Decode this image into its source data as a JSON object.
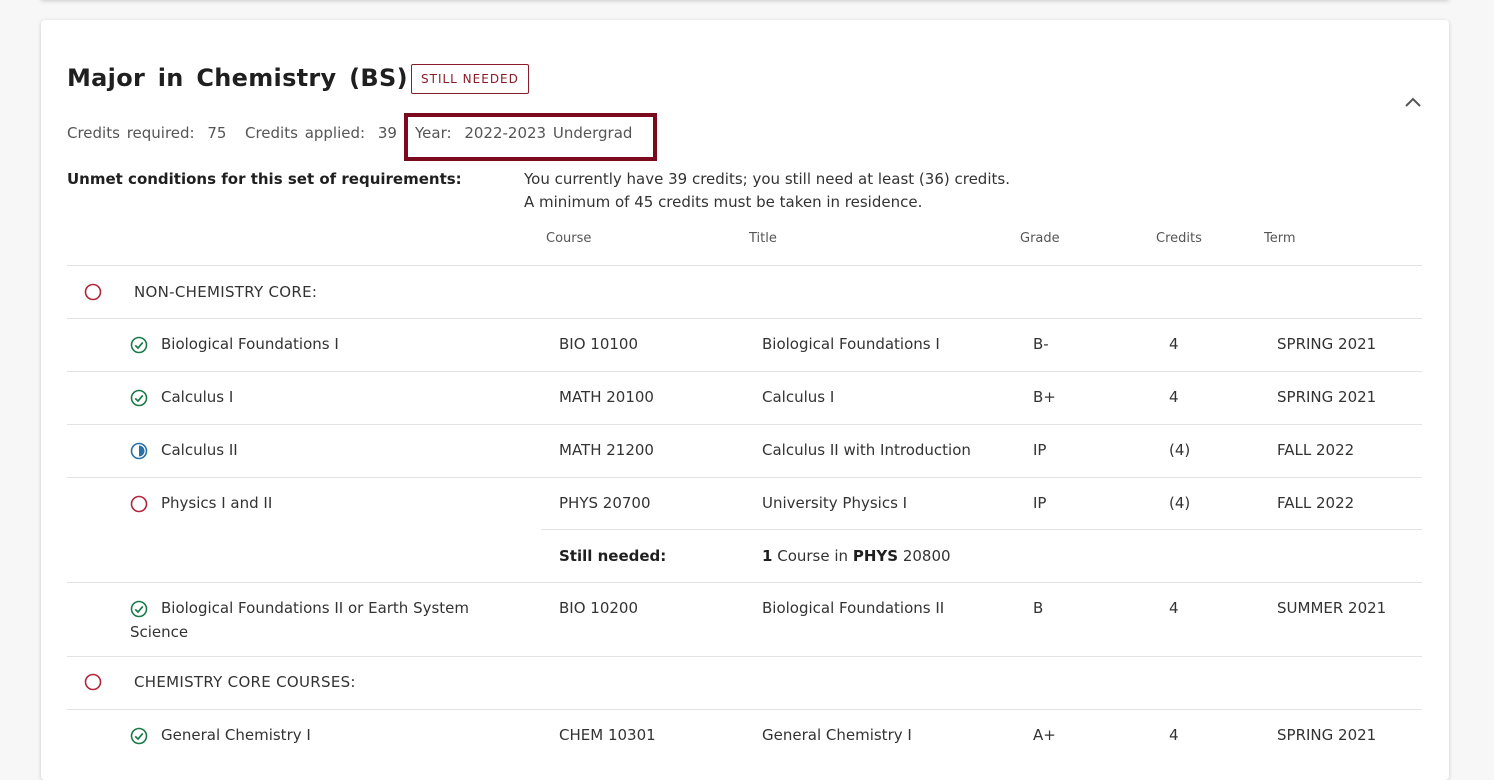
{
  "header": {
    "title": "Major in Chemistry (BS)",
    "status_badge": "STILL NEEDED",
    "credits_required_label": "Credits required:",
    "credits_required": "75",
    "credits_applied_label": "Credits applied:",
    "credits_applied": "39",
    "year_label": "Year:",
    "year": "2022-2023 Undergrad"
  },
  "unmet": {
    "label": "Unmet conditions for this set of requirements:",
    "messages": [
      "You currently have 39 credits; you still need at least (36) credits.",
      "A minimum of 45 credits must be taken in residence."
    ]
  },
  "columns": [
    "Course",
    "Title",
    "Grade",
    "Credits",
    "Term"
  ],
  "groups": [
    {
      "label": "NON-CHEMISTRY CORE:",
      "status": "not-met",
      "rows": [
        {
          "requirement": "Biological Foundations I",
          "status": "complete",
          "course": "BIO 10100",
          "title": "Biological Foundations I",
          "grade": "B-",
          "credits": "4",
          "term": "SPRING 2021"
        },
        {
          "requirement": "Calculus I",
          "status": "complete",
          "course": "MATH 20100",
          "title": "Calculus I",
          "grade": "B+",
          "credits": "4",
          "term": "SPRING 2021"
        },
        {
          "requirement": "Calculus II",
          "status": "in-progress",
          "course": "MATH 21200",
          "title": "Calculus II with Introduction",
          "grade": "IP",
          "credits": "(4)",
          "term": "FALL 2022"
        },
        {
          "requirement": "Physics I and II",
          "status": "not-met",
          "course": "PHYS 20700",
          "title": "University Physics I",
          "grade": "IP",
          "credits": "(4)",
          "term": "FALL 2022",
          "still_needed": {
            "label": "Still needed:",
            "count": "1",
            "word_course": "Course",
            "word_in": "in",
            "subject": "PHYS",
            "number": "20800"
          }
        },
        {
          "requirement_line1": "Biological Foundations II or Earth System",
          "requirement_line2": "Science",
          "status": "complete",
          "course": "BIO 10200",
          "title": "Biological Foundations II",
          "grade": "B",
          "credits": "4",
          "term": "SUMMER 2021"
        }
      ]
    },
    {
      "label": "CHEMISTRY CORE COURSES:",
      "status": "not-met",
      "rows": [
        {
          "requirement": "General Chemistry I",
          "status": "complete",
          "course": "CHEM 10301",
          "title": "General Chemistry I",
          "grade": "A+",
          "credits": "4",
          "term": "SPRING 2021"
        }
      ]
    }
  ],
  "colors": {
    "accent": "#7c0a1f",
    "badge": "#8a1c2a",
    "complete": "#1b7a4a",
    "in_progress": "#2a6fa8",
    "not_met": "#b0283a"
  },
  "icons": {
    "complete": "check-circle-icon",
    "in_progress": "half-circle-icon",
    "not_met": "empty-circle-icon",
    "collapse": "chevron-up-icon"
  }
}
